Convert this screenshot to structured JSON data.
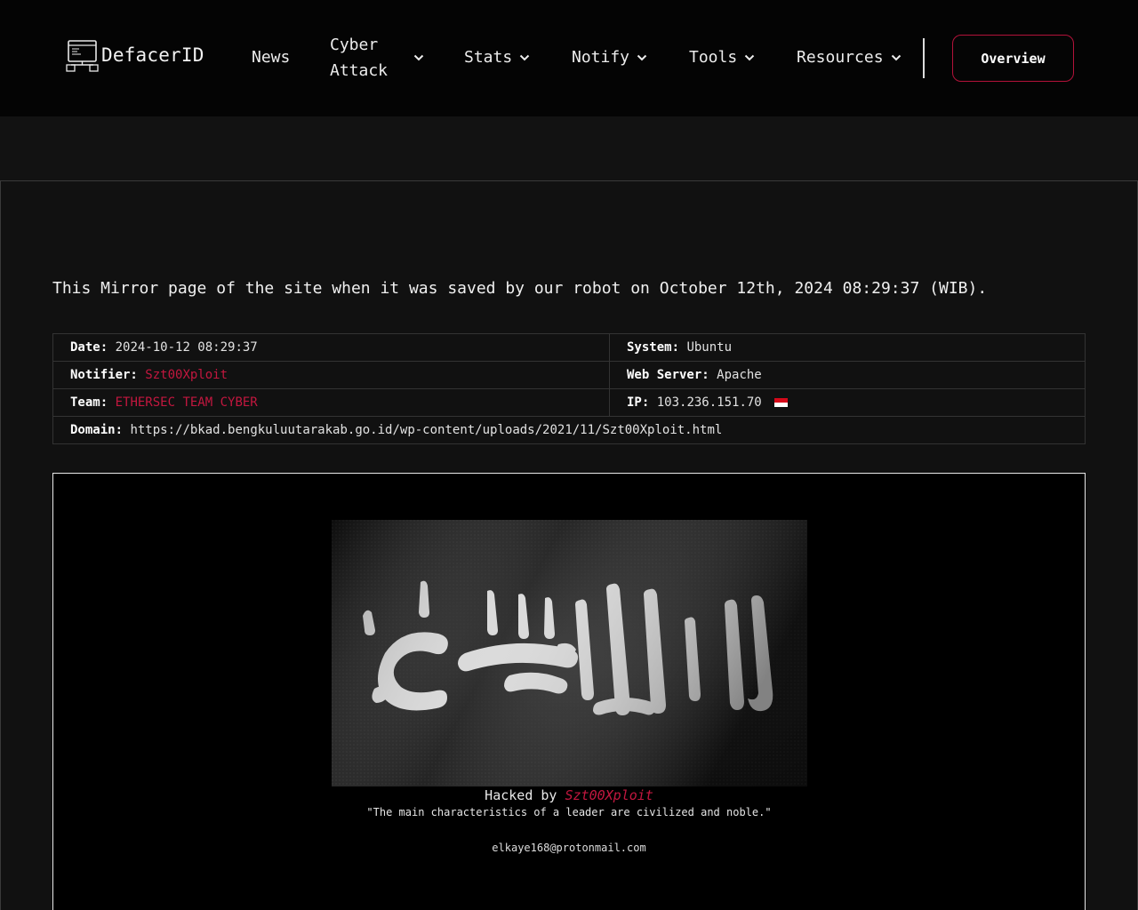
{
  "header": {
    "logo_text": "DefacerID",
    "nav": {
      "news": "News",
      "cyber_attack": "Cyber Attack",
      "stats": "Stats",
      "notify": "Notify",
      "tools": "Tools",
      "resources": "Resources"
    },
    "overview_label": "Overview"
  },
  "mirror_info": {
    "intro": "This Mirror page of the site when it was saved by our robot on October 12th, 2024 08:29:37 (WIB).",
    "date_label": "Date:",
    "date_value": "2024-10-12 08:29:37",
    "system_label": "System:",
    "system_value": "Ubuntu",
    "notifier_label": "Notifier:",
    "notifier_value": "Szt00Xploit",
    "webserver_label": "Web Server:",
    "webserver_value": "Apache",
    "team_label": "Team:",
    "team_value": "ETHERSEC TEAM CYBER",
    "ip_label": "IP:",
    "ip_value": "103.236.151.70",
    "domain_label": "Domain:",
    "domain_value": "https://bkad.bengkuluutarakab.go.id/wp-content/uploads/2021/11/Szt00Xploit.html"
  },
  "mirror_content": {
    "hacked_by_prefix": "Hacked by",
    "hacked_by_name": "Szt00Xploit",
    "quote": "\"The main characteristics of a leader are civilized and noble.\"",
    "email": "elkaye168@protonmail.com"
  },
  "colors": {
    "accent_red": "#c3173f",
    "header_bg": "#040404",
    "page_bg": "#121212"
  }
}
